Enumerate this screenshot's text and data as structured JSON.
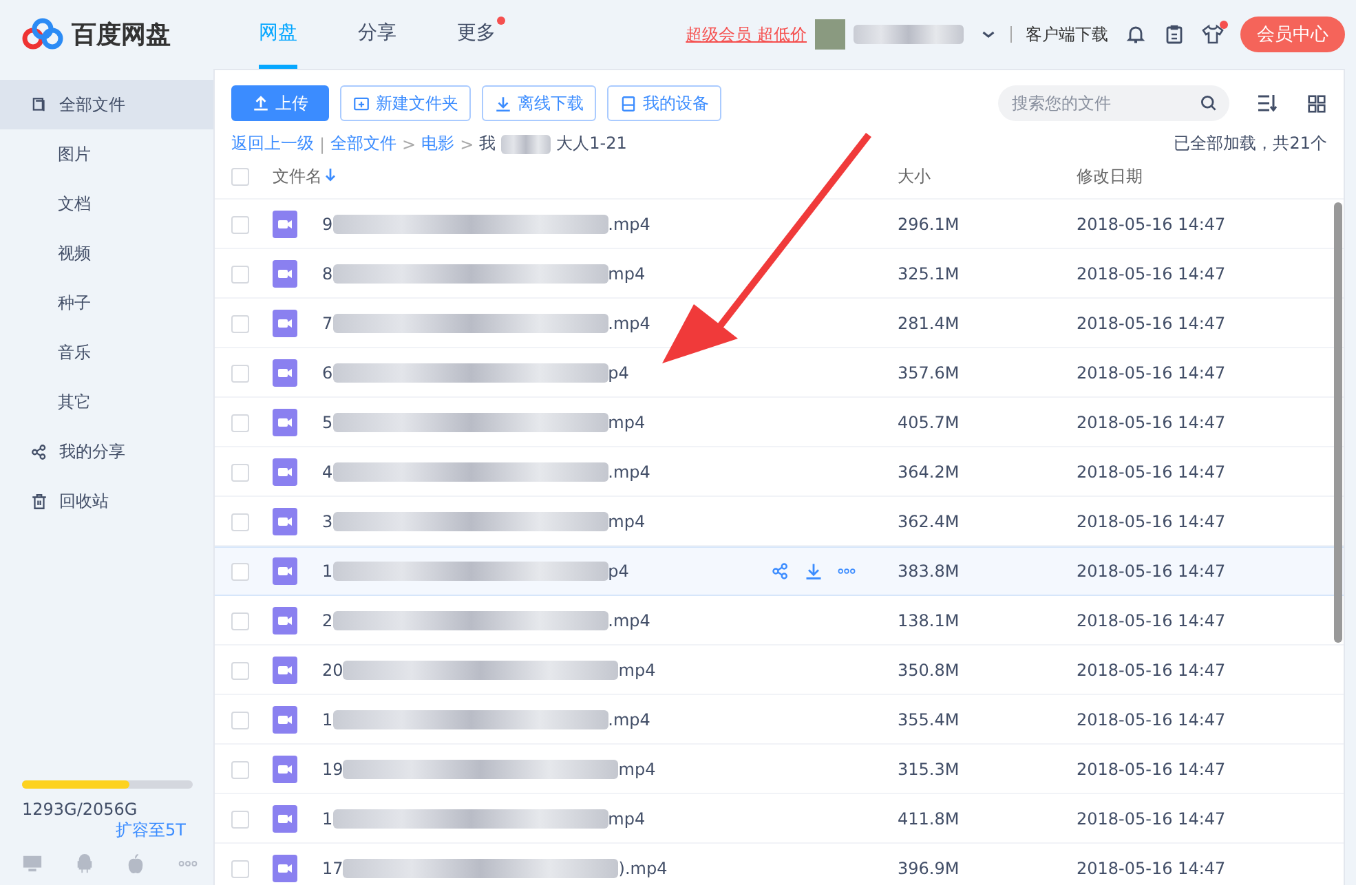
{
  "header": {
    "logo": "百度网盘",
    "tabs": [
      {
        "label": "网盘",
        "selected": true,
        "dot": false
      },
      {
        "label": "分享",
        "selected": false,
        "dot": false
      },
      {
        "label": "更多",
        "selected": false,
        "dot": true
      }
    ],
    "promo": "超级会员 超低价",
    "download": "客户端下载",
    "shirt_dot": true,
    "vip_button": "会员中心"
  },
  "sidebar": {
    "items": [
      {
        "label": "全部文件",
        "selected": true,
        "children": [
          {
            "label": "图片",
            "selected": false
          },
          {
            "label": "文档",
            "selected": false
          },
          {
            "label": "视频",
            "selected": false
          },
          {
            "label": "种子",
            "selected": false
          },
          {
            "label": "音乐",
            "selected": false
          },
          {
            "label": "其它",
            "selected": false
          }
        ]
      },
      {
        "label": "我的分享",
        "selected": false
      },
      {
        "label": "回收站",
        "selected": false
      }
    ],
    "storage": {
      "level": 0.63,
      "text": "1293G/2056G",
      "upgrade": "扩容至5T"
    }
  },
  "toolbar": {
    "buttons": [
      {
        "label": "上传",
        "kind": "primary"
      },
      {
        "label": "新建文件夹",
        "kind": "outline"
      },
      {
        "label": "离线下载",
        "kind": "outline"
      },
      {
        "label": "我的设备",
        "kind": "outline"
      }
    ],
    "search": {
      "placeholder": "搜索您的文件"
    }
  },
  "breadcrumb": {
    "back": "返回上一级",
    "divider": "|",
    "separator": ">",
    "crumbs": [
      "全部文件",
      "电影"
    ],
    "current_prefix": "我",
    "current_suffix": "大人1-21",
    "status": "已全部加载，共21个"
  },
  "table": {
    "all_checked": false,
    "columns": [
      "文件名",
      "大小",
      "修改日期"
    ],
    "rows": [
      {
        "prefix": "9",
        "suffix": ".mp4",
        "size": "296.1M",
        "date": "2018-05-16 14:47",
        "checked": false,
        "hovered": false
      },
      {
        "prefix": "8",
        "suffix": "mp4",
        "size": "325.1M",
        "date": "2018-05-16 14:47",
        "checked": false,
        "hovered": false
      },
      {
        "prefix": "7",
        "suffix": ".mp4",
        "size": "281.4M",
        "date": "2018-05-16 14:47",
        "checked": false,
        "hovered": false
      },
      {
        "prefix": "6",
        "suffix": "p4",
        "size": "357.6M",
        "date": "2018-05-16 14:47",
        "checked": false,
        "hovered": false
      },
      {
        "prefix": "5",
        "suffix": "mp4",
        "size": "405.7M",
        "date": "2018-05-16 14:47",
        "checked": false,
        "hovered": false
      },
      {
        "prefix": "4",
        "suffix": ".mp4",
        "size": "364.2M",
        "date": "2018-05-16 14:47",
        "checked": false,
        "hovered": false
      },
      {
        "prefix": "3",
        "suffix": "mp4",
        "size": "362.4M",
        "date": "2018-05-16 14:47",
        "checked": false,
        "hovered": false
      },
      {
        "prefix": "1",
        "suffix": "p4",
        "size": "383.8M",
        "date": "2018-05-16 14:47",
        "checked": false,
        "hovered": true
      },
      {
        "prefix": "2",
        "suffix": ".mp4",
        "size": "138.1M",
        "date": "2018-05-16 14:47",
        "checked": false,
        "hovered": false
      },
      {
        "prefix": "20",
        "suffix": "mp4",
        "size": "350.8M",
        "date": "2018-05-16 14:47",
        "checked": false,
        "hovered": false
      },
      {
        "prefix": "1",
        "suffix": ".mp4",
        "size": "355.4M",
        "date": "2018-05-16 14:47",
        "checked": false,
        "hovered": false
      },
      {
        "prefix": "19",
        "suffix": "mp4",
        "size": "315.3M",
        "date": "2018-05-16 14:47",
        "checked": false,
        "hovered": false
      },
      {
        "prefix": "1",
        "suffix": "mp4",
        "size": "411.8M",
        "date": "2018-05-16 14:47",
        "checked": false,
        "hovered": false
      },
      {
        "prefix": "17",
        "suffix": ").mp4",
        "size": "396.9M",
        "date": "2018-05-16 14:47",
        "checked": false,
        "hovered": false
      }
    ]
  }
}
